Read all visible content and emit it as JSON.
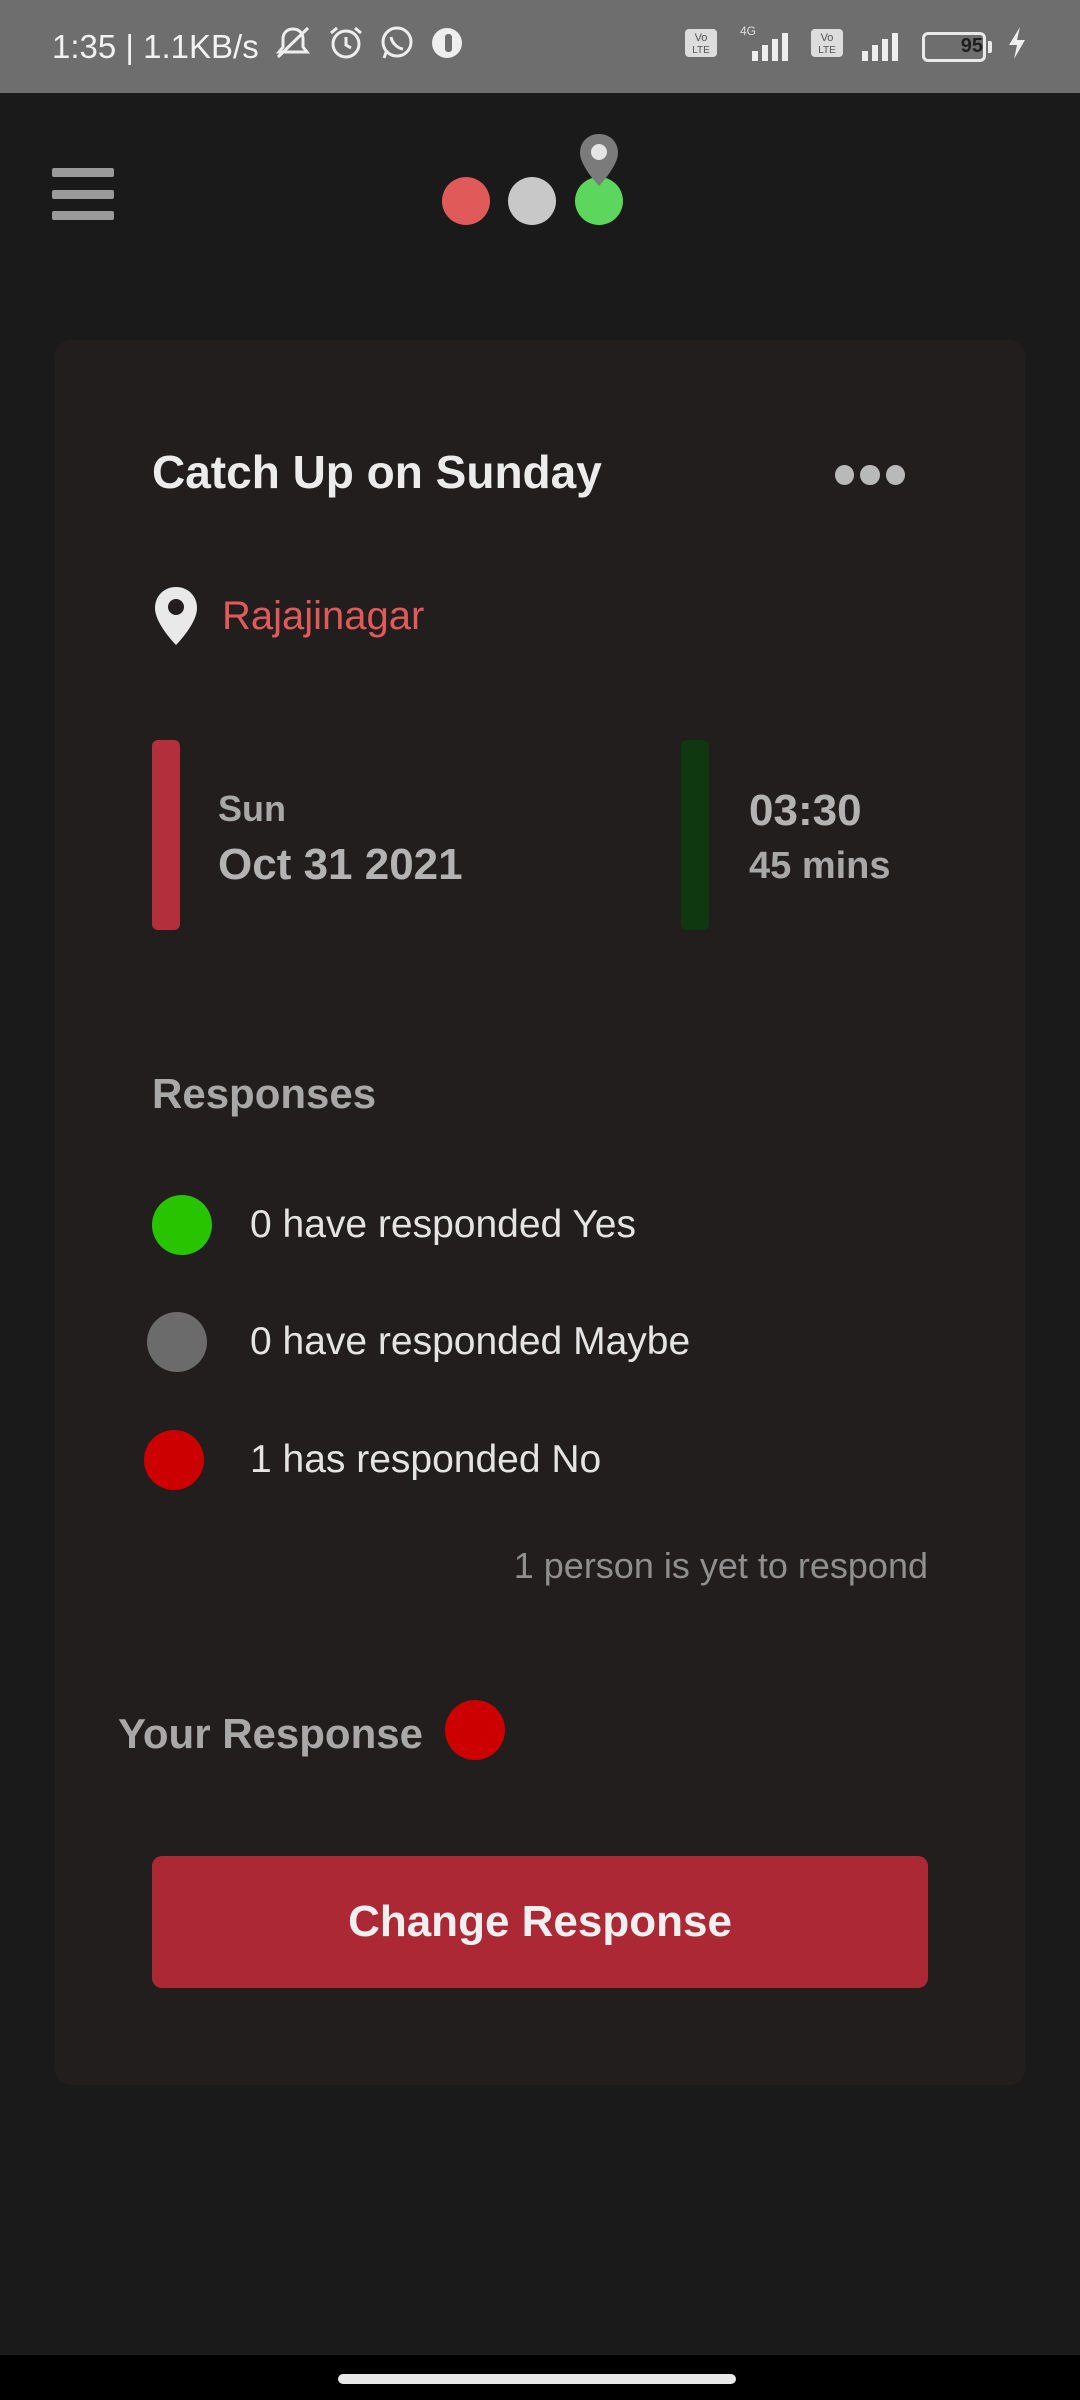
{
  "status_bar": {
    "time_speed": "1:35 | 1.1KB/s",
    "icons": [
      "mute-icon",
      "alarm-icon",
      "whatsapp-icon",
      "app-notification-icon",
      "volte-icon",
      "signal-icon",
      "charging-icon"
    ],
    "network_label": "4G",
    "volte_label": "Vo LTE",
    "battery": "95",
    "battery_level": 0.95
  },
  "header": {
    "logo_colors": [
      "#e05a5a",
      "#c8c8c8",
      "#5cd65c"
    ],
    "pin_color": "#7b7b7b"
  },
  "event": {
    "title": "Catch Up on Sunday",
    "location": "Rajajinagar",
    "day": "Sun",
    "date": "Oct 31 2021",
    "time": "03:30",
    "duration": "45 mins"
  },
  "responses": {
    "heading": "Responses",
    "items": [
      {
        "text": "0 have responded Yes",
        "color": "#29c400"
      },
      {
        "text": "0 have responded Maybe",
        "color": "#6b6b6b"
      },
      {
        "text": "1 has responded No",
        "color": "#cc0000"
      }
    ],
    "pending": "1 person is yet to respond"
  },
  "your_response": {
    "label": "Your Response",
    "color": "#cc0000"
  },
  "actions": {
    "change_response": "Change Response"
  },
  "colors": {
    "accent": "#ac2834",
    "location_text": "#e05a5a",
    "background": "#1b1a1a",
    "card": "#221e1e"
  }
}
